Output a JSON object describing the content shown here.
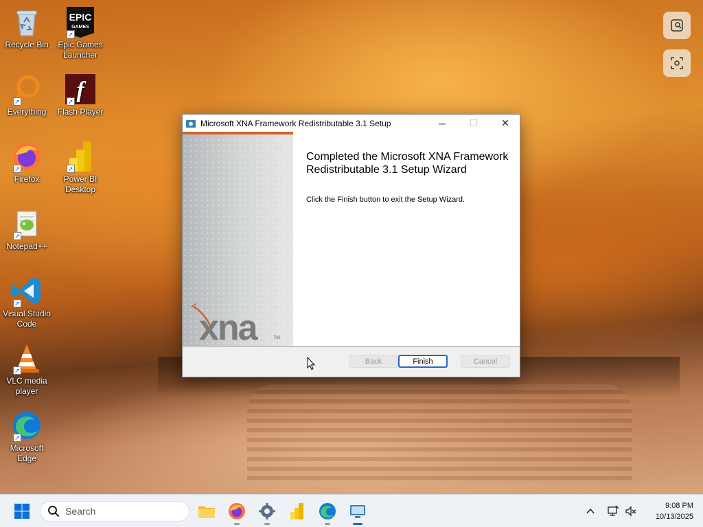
{
  "desktop": {
    "icons": [
      {
        "label": "Recycle Bin",
        "icon": "recycle-bin-icon"
      },
      {
        "label": "Epic Games Launcher",
        "icon": "epic-games-icon"
      },
      {
        "label": "Everything",
        "icon": "everything-search-icon"
      },
      {
        "label": "Flash Player",
        "icon": "flash-player-icon"
      },
      {
        "label": "Firefox",
        "icon": "firefox-icon"
      },
      {
        "label": "Power BI Desktop",
        "icon": "power-bi-icon"
      },
      {
        "label": "Notepad++",
        "icon": "notepadpp-icon"
      },
      {
        "label": "Visual Studio Code",
        "icon": "vscode-icon"
      },
      {
        "label": "VLC media player",
        "icon": "vlc-icon"
      },
      {
        "label": "Microsoft Edge",
        "icon": "edge-icon"
      }
    ],
    "epic_logo_text": "EPIC\nGAMES"
  },
  "dialog": {
    "title": "Microsoft XNA Framework Redistributable 3.1 Setup",
    "heading": "Completed the Microsoft XNA Framework Redistributable 3.1 Setup Wizard",
    "body": "Click the Finish button to exit the Setup Wizard.",
    "logo_text": "xna",
    "logo_tm": "TM",
    "buttons": {
      "back": "Back",
      "finish": "Finish",
      "cancel": "Cancel"
    },
    "titlebar_controls": {
      "minimize": "─",
      "maximize": "☐",
      "close": "✕"
    }
  },
  "taskbar": {
    "search_placeholder": "Search",
    "apps": [
      "file-explorer-icon",
      "firefox-icon",
      "settings-icon",
      "power-bi-icon",
      "edge-icon",
      "remote-desktop-icon"
    ],
    "clock_time": "9:08 PM",
    "clock_date": "10/13/2025",
    "tray_chevron": "^"
  }
}
